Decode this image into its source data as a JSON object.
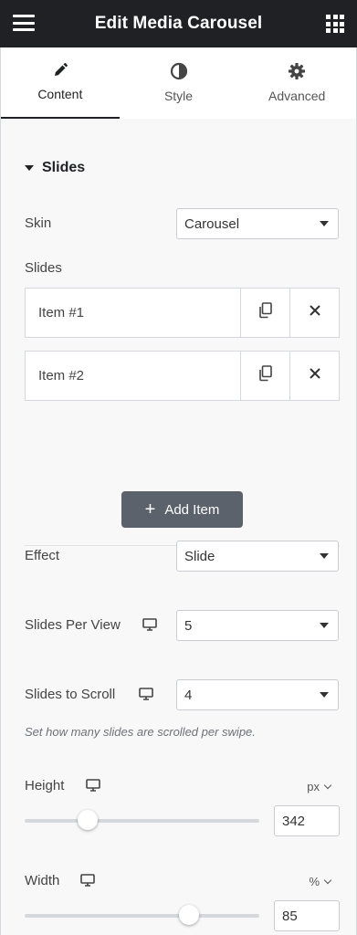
{
  "header": {
    "title": "Edit Media Carousel",
    "menu_icon": "hamburger-icon",
    "apps_icon": "grid-icon"
  },
  "tabs": [
    {
      "label": "Content",
      "icon": "pencil-icon",
      "active": true
    },
    {
      "label": "Style",
      "icon": "half-circle-icon",
      "active": false
    },
    {
      "label": "Advanced",
      "icon": "gear-icon",
      "active": false
    }
  ],
  "section": {
    "title": "Slides"
  },
  "skin": {
    "label": "Skin",
    "value": "Carousel"
  },
  "slides": {
    "label": "Slides",
    "items": [
      {
        "label": "Item #1"
      },
      {
        "label": "Item #2"
      }
    ],
    "add_label": "Add Item"
  },
  "effect": {
    "label": "Effect",
    "value": "Slide"
  },
  "slides_per_view": {
    "label": "Slides Per View",
    "value": "5"
  },
  "slides_to_scroll": {
    "label": "Slides to Scroll",
    "value": "4",
    "help": "Set how many slides are scrolled per swipe."
  },
  "height": {
    "label": "Height",
    "unit": "px",
    "value": "342",
    "slider_fraction": 0.27
  },
  "width": {
    "label": "Width",
    "unit": "%",
    "value": "85",
    "slider_fraction": 0.7
  },
  "colors": {
    "header_bg": "#1f2124",
    "button_bg": "#5b626b",
    "accent": "#1f2124"
  }
}
